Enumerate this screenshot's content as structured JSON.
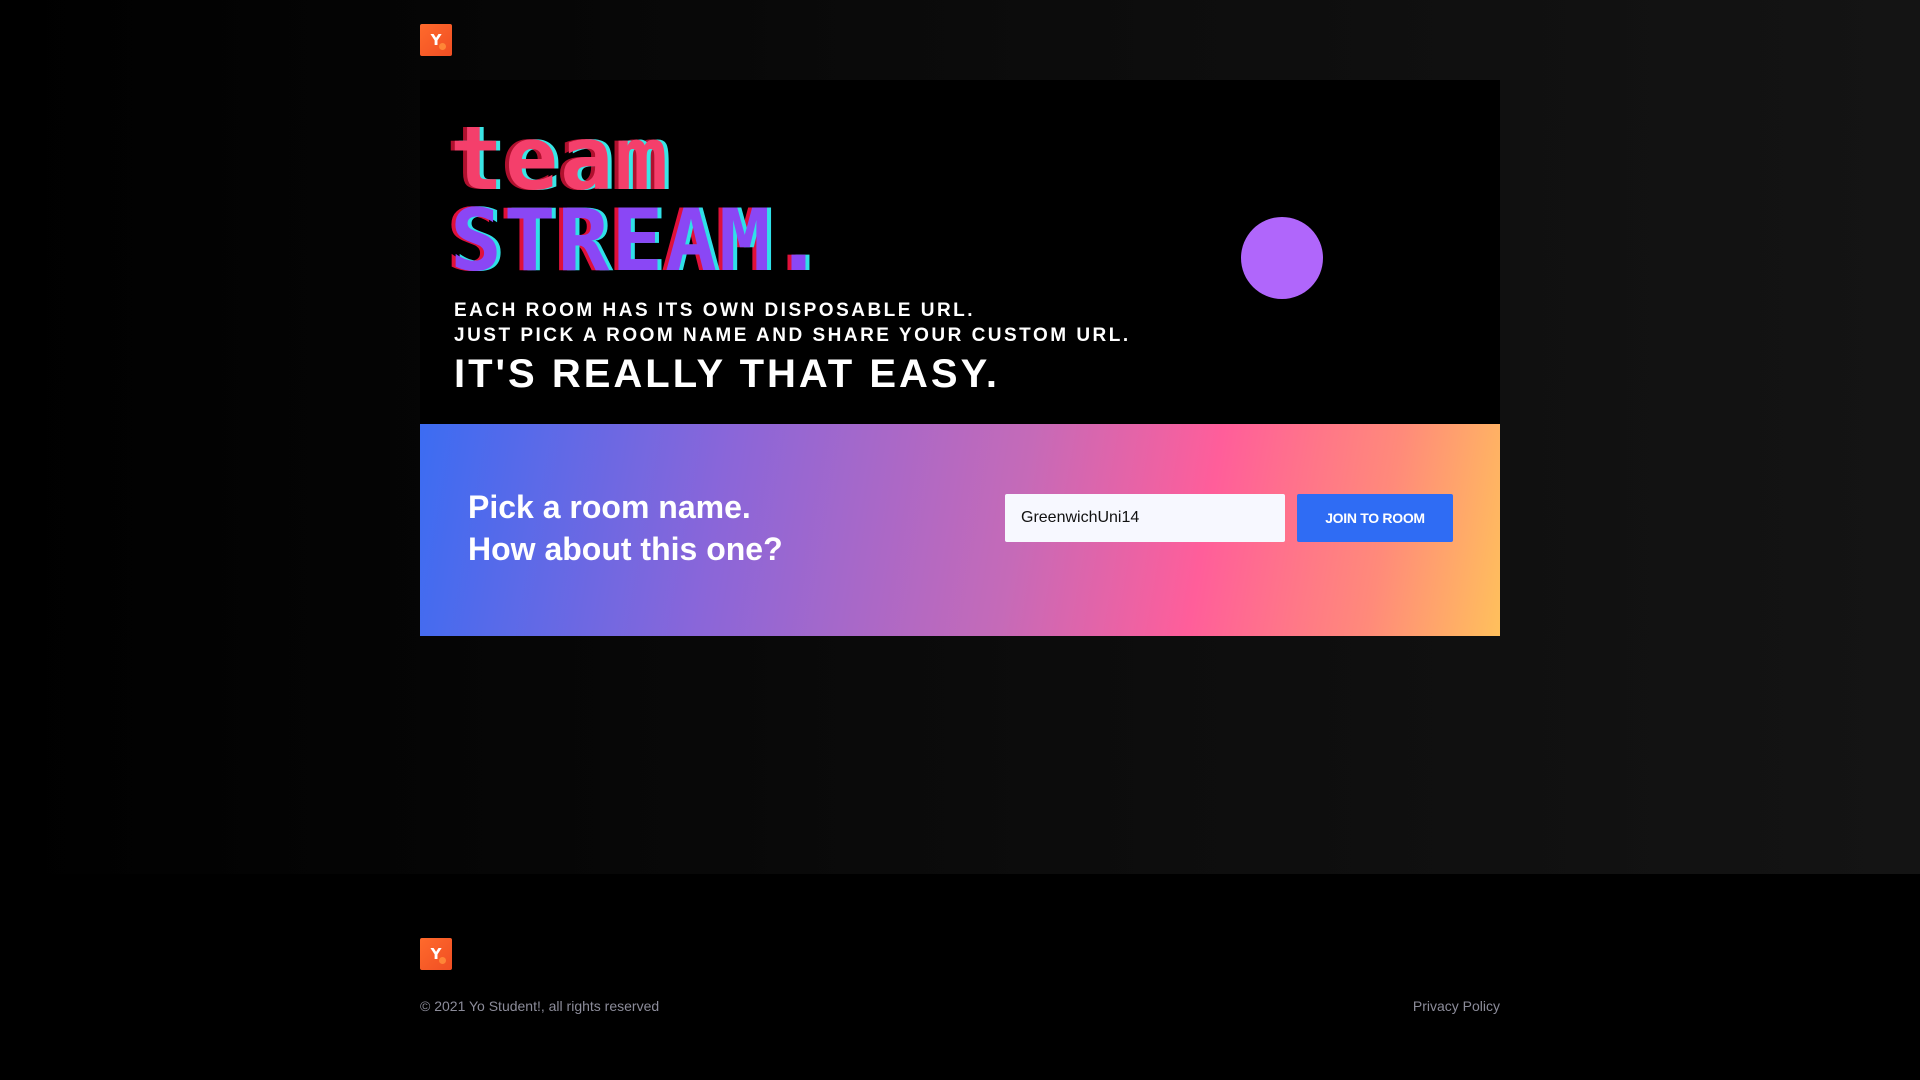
{
  "header": {
    "logo_letter": "Y"
  },
  "hero": {
    "brand_line1": "Team",
    "brand_line2": "STREAM.",
    "tagline_line1": "EACH ROOM HAS ITS OWN DISPOSABLE URL.",
    "tagline_line2": "JUST PICK A ROOM NAME AND SHARE YOUR CUSTOM URL.",
    "headline": "IT'S REALLY THAT EASY."
  },
  "cta": {
    "prompt_line1": "Pick a room name.",
    "prompt_line2": "How about this one?",
    "room_input_value": "GreenwichUni14",
    "join_button_label": "JOIN TO ROOM"
  },
  "footer": {
    "logo_letter": "Y",
    "copyright": "© 2021 Yo Student!, all rights reserved",
    "privacy_link": "Privacy Policy"
  },
  "colors": {
    "accent_pink": "#f43f6b",
    "accent_purple": "#8a47f5",
    "circle": "#b066fb",
    "button": "#2f6cf4"
  }
}
